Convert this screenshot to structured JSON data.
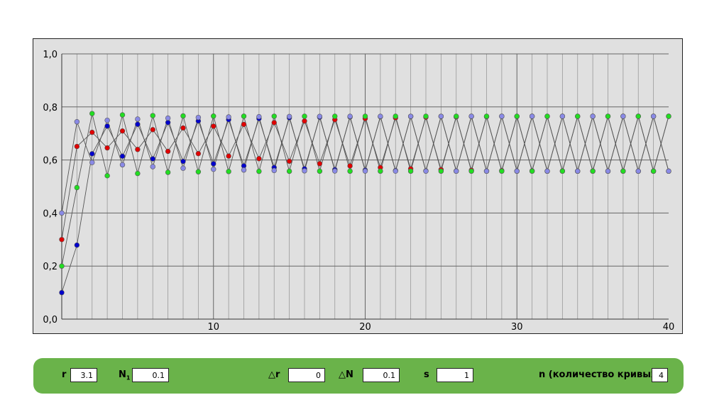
{
  "chart_data": {
    "type": "scatter",
    "x_ticks": [
      "10",
      "20",
      "30",
      "40"
    ],
    "y_ticks": [
      "0,0",
      "0,2",
      "0,4",
      "0,6",
      "0,8",
      "1,0"
    ],
    "xlim": [
      0,
      40
    ],
    "ylim": [
      0,
      1
    ],
    "grid": true,
    "legend": "none",
    "r": 3.1,
    "x": [
      0,
      1,
      2,
      3,
      4,
      5,
      6,
      7,
      8,
      9,
      10,
      11,
      12,
      13,
      14,
      15,
      16,
      17,
      18,
      19,
      20,
      21,
      22,
      23,
      24,
      25,
      26,
      27,
      28,
      29,
      30,
      31,
      32,
      33,
      34,
      35,
      36,
      37,
      38,
      39,
      40
    ],
    "series": [
      {
        "color": "#0000cc",
        "values": [
          0.1,
          0.279,
          0.6235,
          0.7277,
          0.6143,
          0.7346,
          0.6044,
          0.7412,
          0.5947,
          0.7471,
          0.5857,
          0.7522,
          0.5778,
          0.7562,
          0.5715,
          0.7592,
          0.5667,
          0.7613,
          0.5634,
          0.7625,
          0.5614,
          0.7634,
          0.5599,
          0.764,
          0.5589,
          0.7643,
          0.5584,
          0.7645,
          0.5582,
          0.7646,
          0.558,
          0.7647,
          0.5579,
          0.7647,
          0.5579,
          0.7647,
          0.5579,
          0.7647,
          0.5579,
          0.7647,
          0.5579
        ]
      },
      {
        "color": "#e00000",
        "values": [
          0.3,
          0.651,
          0.7043,
          0.6456,
          0.7093,
          0.6397,
          0.7144,
          0.6325,
          0.7207,
          0.624,
          0.7274,
          0.6147,
          0.7342,
          0.605,
          0.7408,
          0.5953,
          0.7468,
          0.5861,
          0.7519,
          0.5777,
          0.7562,
          0.5716,
          0.7591,
          0.5668,
          0.7612,
          0.5636,
          0.7625,
          0.5613,
          0.7634,
          0.5599,
          0.764,
          0.5588,
          0.7643,
          0.5585,
          0.7645,
          0.5582,
          0.7646,
          0.558,
          0.7647,
          0.5579,
          0.7647
        ]
      },
      {
        "color": "#22dd22",
        "values": [
          0.2,
          0.496,
          0.775,
          0.5406,
          0.7699,
          0.5492,
          0.7673,
          0.5535,
          0.7661,
          0.5555,
          0.7655,
          0.5566,
          0.7651,
          0.5572,
          0.7649,
          0.5575,
          0.7648,
          0.5577,
          0.7647,
          0.5578,
          0.7647,
          0.5579,
          0.7647,
          0.5579,
          0.7647,
          0.5579,
          0.7647,
          0.5579,
          0.7647,
          0.5579,
          0.7647,
          0.5579,
          0.7647,
          0.5579,
          0.7647,
          0.5579,
          0.7647,
          0.5579,
          0.7647,
          0.5579,
          0.7647
        ]
      },
      {
        "color": "#8a8ae6",
        "values": [
          0.4,
          0.744,
          0.5905,
          0.7496,
          0.5819,
          0.7541,
          0.5748,
          0.7578,
          0.5689,
          0.7603,
          0.565,
          0.762,
          0.5623,
          0.7631,
          0.5605,
          0.7638,
          0.5593,
          0.7642,
          0.5587,
          0.7644,
          0.5583,
          0.7645,
          0.5581,
          0.7646,
          0.558,
          0.7646,
          0.5579,
          0.7647,
          0.5579,
          0.7647,
          0.5579,
          0.7647,
          0.5579,
          0.7647,
          0.5579,
          0.7647,
          0.5579,
          0.7647,
          0.5579,
          0.7647,
          0.5579
        ]
      }
    ]
  },
  "controls": {
    "r_label": "r",
    "r_value": "3.1",
    "n1_label": "N",
    "n1_sub": "1",
    "n1_value": "0.1",
    "dr_label": "△r",
    "dr_value": "0",
    "dn_label": "△N",
    "dn_value": "0.1",
    "s_label": "s",
    "s_value": "1",
    "n_label": "n (количество кривых):",
    "n_value": "4"
  }
}
